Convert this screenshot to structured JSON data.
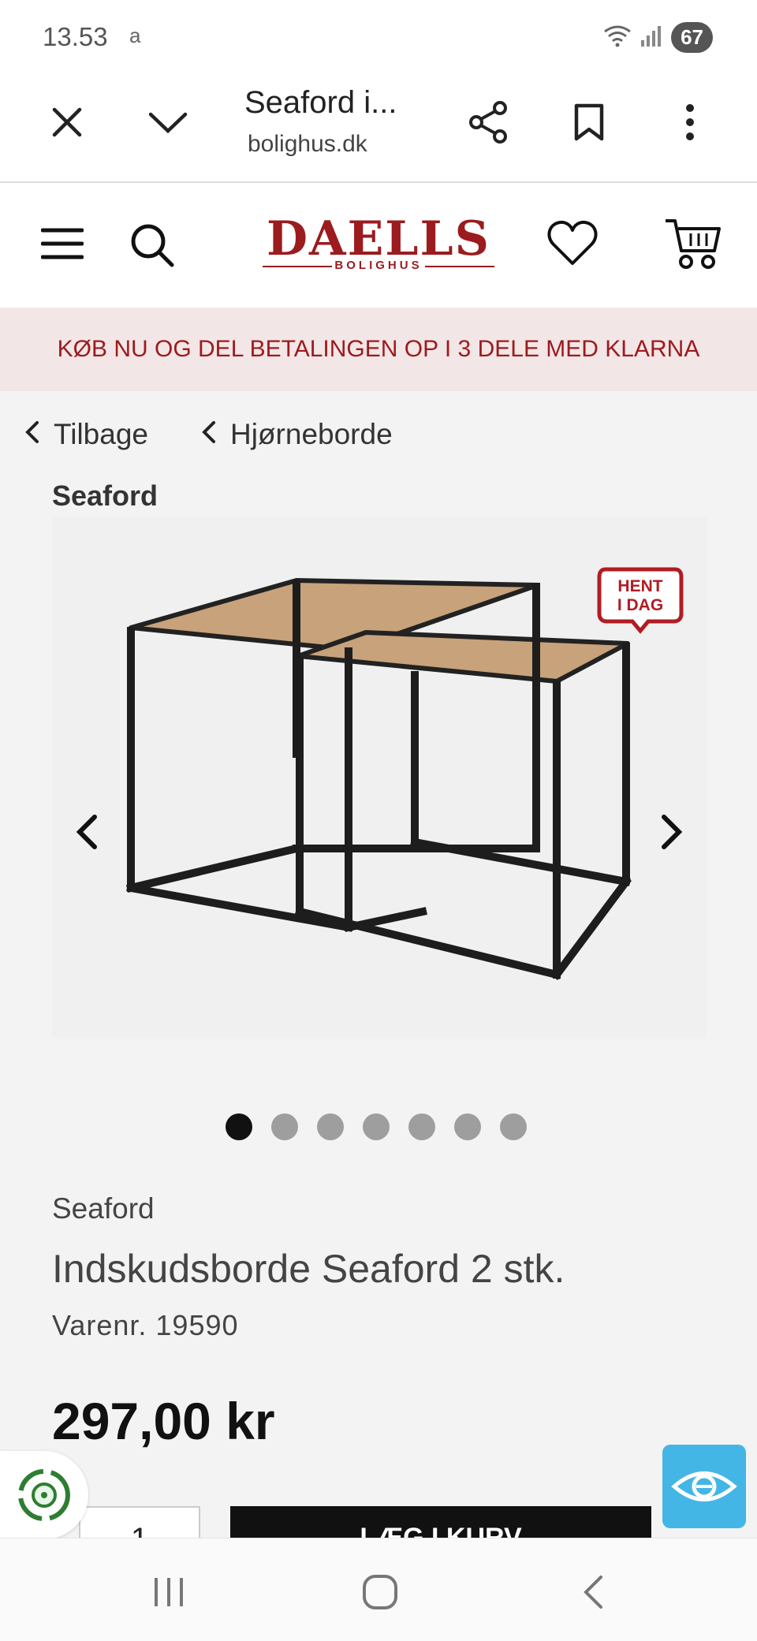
{
  "status_bar": {
    "time": "13.53",
    "app_indicator": "a",
    "battery": "67",
    "icons": [
      "wifi-icon",
      "signal-icon",
      "battery-icon"
    ]
  },
  "browser": {
    "tab_title": "Seaford i...",
    "domain": "bolighus.dk",
    "icons": [
      "close-icon",
      "chevron-down-icon",
      "share-icon",
      "bookmark-icon",
      "more-vertical-icon"
    ]
  },
  "site_header": {
    "logo_text": "DAELLS",
    "logo_subtext": "BOLIGHUS",
    "icons": [
      "menu-icon",
      "search-icon",
      "heart-icon",
      "cart-icon"
    ],
    "brand_color": "#9b1b1e"
  },
  "banner": {
    "text": "KØB NU OG DEL BETALINGEN OP I 3 DELE MED KLARNA"
  },
  "breadcrumb": {
    "back_label": "Tilbage",
    "category_label": "Hjørneborde"
  },
  "brand_heading": "Seaford",
  "gallery": {
    "badge_line1": "HENT",
    "badge_line2": "I DAG",
    "image_count": 7,
    "active_index": 0
  },
  "product": {
    "brand": "Seaford",
    "title": "Indskudsborde Seaford 2 stk.",
    "sku": "Varenr. 19590",
    "price": "297,00 kr"
  },
  "purchase": {
    "quantity": "1",
    "add_to_cart_label": "LÆG I KURV"
  },
  "nav_bar": {
    "icons": [
      "recents-icon",
      "home-icon",
      "back-icon"
    ]
  }
}
